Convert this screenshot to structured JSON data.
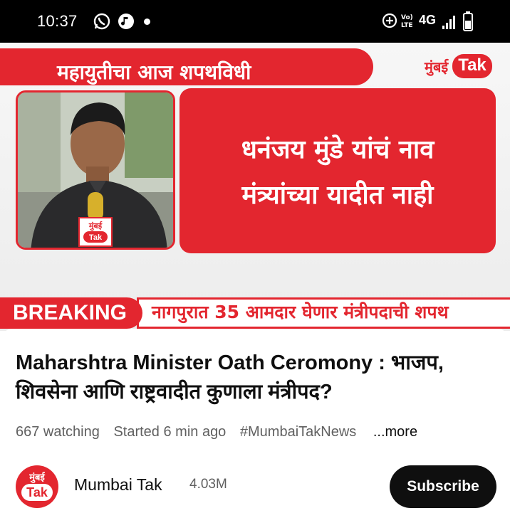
{
  "status_bar": {
    "time": "10:37",
    "network": "4G",
    "icons": [
      "whatsapp-icon",
      "music-icon",
      "hotspot-icon",
      "volte-icon",
      "signal-icon",
      "battery-icon"
    ]
  },
  "video": {
    "headline": "महायुतीचा आज शपथविधी",
    "brand_mumbai": "मुंबई",
    "brand_tak": "Tak",
    "quote_line1": "धनंजय मुंडे यांचं नाव",
    "quote_line2": "मंत्र्यांच्या यादीत नाही",
    "mic_label_top": "मुंबई",
    "mic_label_bottom": "Tak",
    "breaking_label": "BREAKING",
    "breaking_text": "नागपुरात 35 आमदार घेणार मंत्रीपदाची शपथ",
    "accent_color": "#e3262f"
  },
  "details": {
    "title": "Maharshtra Minister Oath Ceromony : भाजप, शिवसेना आणि राष्ट्रवादीत कुणाला मंत्रीपद?",
    "watching": "667 watching",
    "started": "Started 6 min ago",
    "hashtag": "#MumbaiTakNews",
    "more": "...more"
  },
  "channel": {
    "avatar_top": "मुंबई",
    "avatar_tak": "Tak",
    "name": "Mumbai Tak",
    "subscribers": "4.03M",
    "subscribe_label": "Subscribe"
  }
}
